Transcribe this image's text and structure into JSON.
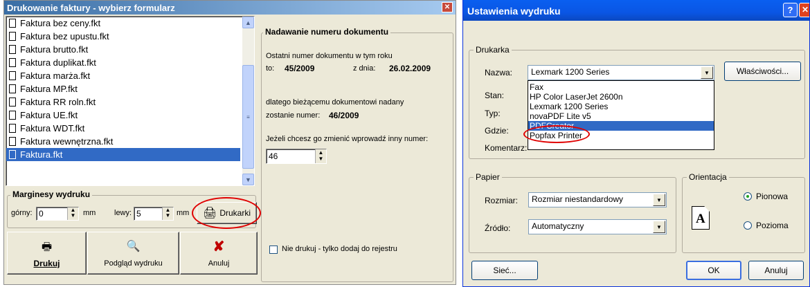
{
  "left_dialog": {
    "title": "Drukowanie faktury - wybierz formularz",
    "close_glyph": "✕",
    "files": [
      "Faktura bez ceny.fkt",
      "Faktura bez upustu.fkt",
      "Faktura brutto.fkt",
      "Faktura duplikat.fkt",
      "Faktura marża.fkt",
      "Faktura MP.fkt",
      "Faktura RR roln.fkt",
      "Faktura UE.fkt",
      "Faktura WDT.fkt",
      "Faktura wewnętrzna.fkt",
      "Faktura.fkt"
    ],
    "selected_file": "Faktura.fkt",
    "margins": {
      "group_label": "Marginesy wydruku",
      "top_label": "górny:",
      "top_value": "0",
      "left_label": "lewy:",
      "left_value": "5",
      "unit": "mm"
    },
    "printers_button": "Drukarki",
    "buttons": {
      "print": "Drukuj",
      "preview": "Podgląd wydruku",
      "cancel": "Anuluj"
    },
    "numbering": {
      "group_label": "Nadawanie numeru dokumentu",
      "last_number_text": "Ostatni numer dokumentu  w tym roku",
      "to_label": "to:",
      "last_number": "45/2009",
      "date_label": "z dnia:",
      "date": "26.02.2009",
      "assigned_text": "dlatego bieżącemu dokumentowi nadany",
      "assigned_label": "zostanie numer:",
      "assigned_number": "46/2009",
      "change_text": "Jeżeli chcesz go zmienić wprowadź inny numer:",
      "number_input": "46",
      "no_print_checkbox": "Nie drukuj - tylko dodaj do rejestru"
    },
    "colors": {
      "title_bar": "#3a6ea5",
      "selection": "#316ac5",
      "highlight_circle": "#e00000"
    }
  },
  "right_dialog": {
    "title": "Ustawienia wydruku",
    "help_glyph": "?",
    "close_glyph": "✕",
    "printer_group": "Drukarka",
    "name_label": "Nazwa:",
    "name_value": "Lexmark 1200 Series",
    "properties_button": "Właściwości...",
    "status_label": "Stan:",
    "type_label": "Typ:",
    "where_label": "Gdzie:",
    "comment_label": "Komentarz:",
    "printer_options": [
      "Fax",
      "HP Color LaserJet 2600n",
      "Lexmark 1200 Series",
      "novaPDF Lite v5",
      "PDFCreator",
      "Popfax Printer"
    ],
    "selected_printer": "PDFCreator",
    "paper_group": "Papier",
    "size_label": "Rozmiar:",
    "size_value": "Rozmiar niestandardowy",
    "source_label": "Źródło:",
    "source_value": "Automatyczny",
    "orientation_group": "Orientacja",
    "portrait": "Pionowa",
    "landscape": "Pozioma",
    "orientation_icon_letter": "A",
    "network_button": "Sieć...",
    "ok_button": "OK",
    "cancel_button": "Anuluj",
    "colors": {
      "title_bar": "#0a56e4",
      "close_button": "#e0421f"
    }
  }
}
